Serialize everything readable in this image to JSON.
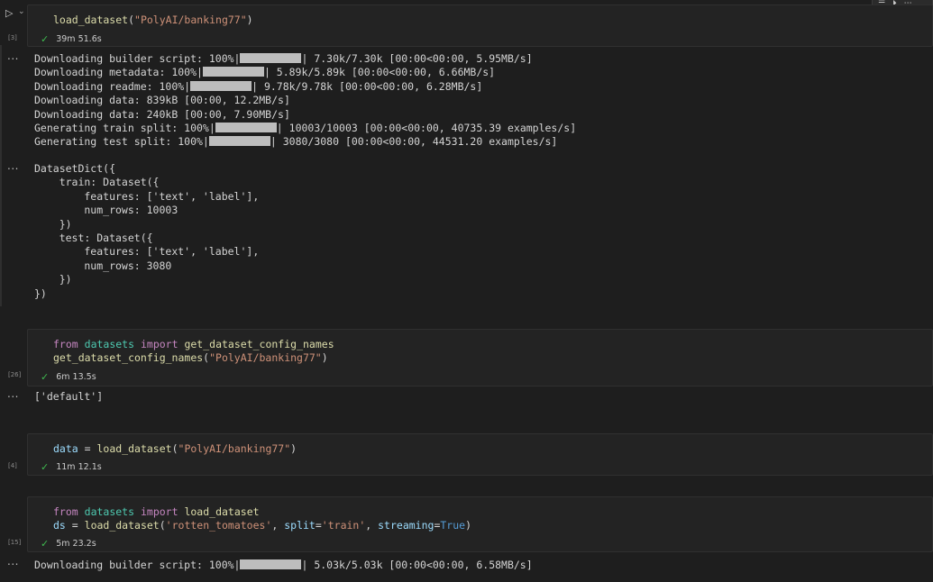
{
  "cells": [
    {
      "exec": "[3]",
      "time": "39m 51.6s",
      "code": [
        [
          {
            "t": "fn",
            "v": "load_dataset"
          },
          {
            "t": "op",
            "v": "("
          },
          {
            "t": "str",
            "v": "\"PolyAI/banking77\""
          },
          {
            "t": "op",
            "v": ")"
          }
        ]
      ]
    },
    {
      "exec": "[26]",
      "time": "6m 13.5s",
      "code": [
        [
          {
            "t": "kw",
            "v": "from"
          },
          {
            "t": "op",
            "v": " "
          },
          {
            "t": "mod",
            "v": "datasets"
          },
          {
            "t": "op",
            "v": " "
          },
          {
            "t": "kw",
            "v": "import"
          },
          {
            "t": "op",
            "v": " "
          },
          {
            "t": "fn",
            "v": "get_dataset_config_names"
          }
        ],
        [
          {
            "t": "fn",
            "v": "get_dataset_config_names"
          },
          {
            "t": "op",
            "v": "("
          },
          {
            "t": "str",
            "v": "\"PolyAI/banking77\""
          },
          {
            "t": "op",
            "v": ")"
          }
        ]
      ]
    },
    {
      "exec": "[4]",
      "time": "11m 12.1s",
      "code": [
        [
          {
            "t": "var",
            "v": "data"
          },
          {
            "t": "op",
            "v": " = "
          },
          {
            "t": "fn",
            "v": "load_dataset"
          },
          {
            "t": "op",
            "v": "("
          },
          {
            "t": "str",
            "v": "\"PolyAI/banking77\""
          },
          {
            "t": "op",
            "v": ")"
          }
        ]
      ]
    },
    {
      "exec": "[15]",
      "time": "5m 23.2s",
      "code": [
        [
          {
            "t": "kw",
            "v": "from"
          },
          {
            "t": "op",
            "v": " "
          },
          {
            "t": "mod",
            "v": "datasets"
          },
          {
            "t": "op",
            "v": " "
          },
          {
            "t": "kw",
            "v": "import"
          },
          {
            "t": "op",
            "v": " "
          },
          {
            "t": "fn",
            "v": "load_dataset"
          }
        ],
        [
          {
            "t": "var",
            "v": "ds"
          },
          {
            "t": "op",
            "v": " = "
          },
          {
            "t": "fn",
            "v": "load_dataset"
          },
          {
            "t": "op",
            "v": "("
          },
          {
            "t": "str",
            "v": "'rotten_tomatoes'"
          },
          {
            "t": "op",
            "v": ", "
          },
          {
            "t": "var",
            "v": "split"
          },
          {
            "t": "op",
            "v": "="
          },
          {
            "t": "str",
            "v": "'train'"
          },
          {
            "t": "op",
            "v": ", "
          },
          {
            "t": "var",
            "v": "streaming"
          },
          {
            "t": "op",
            "v": "="
          },
          {
            "t": "const",
            "v": "True"
          },
          {
            "t": "op",
            "v": ")"
          }
        ]
      ]
    }
  ],
  "outputs": {
    "ellipsis": "...",
    "progress1": [
      {
        "pre": "Downloading builder script: 100%|",
        "post": "| 7.30k/7.30k [00:00<00:00, 5.95MB/s]"
      },
      {
        "pre": "Downloading metadata: 100%|",
        "post": "| 5.89k/5.89k [00:00<00:00, 6.66MB/s]"
      },
      {
        "pre": "Downloading readme: 100%|",
        "post": "| 9.78k/9.78k [00:00<00:00, 6.28MB/s]"
      },
      {
        "pre": "Downloading data: 839kB [00:00, 12.2MB/s]",
        "post": null
      },
      {
        "pre": "Downloading data: 240kB [00:00, 7.90MB/s]",
        "post": null
      },
      {
        "pre": "Generating train split: 100%|",
        "post": "| 10003/10003 [00:00<00:00, 40735.39 examples/s]"
      },
      {
        "pre": "Generating test split: 100%|",
        "post": "| 3080/3080 [00:00<00:00, 44531.20 examples/s]"
      }
    ],
    "datasetdict": [
      "DatasetDict({",
      "    train: Dataset({",
      "        features: ['text', 'label'],",
      "        num_rows: 10003",
      "    })",
      "    test: Dataset({",
      "        features: ['text', 'label'],",
      "        num_rows: 3080",
      "    })",
      "})"
    ],
    "config_names": "['default']",
    "progress2": [
      {
        "pre": "Downloading builder script: 100%|",
        "post": "| 5.03k/5.03k [00:00<00:00, 6.58MB/s]"
      }
    ]
  },
  "icons": {
    "run": "play-icon",
    "expand": "chevron-down-icon",
    "check": "check-icon"
  }
}
